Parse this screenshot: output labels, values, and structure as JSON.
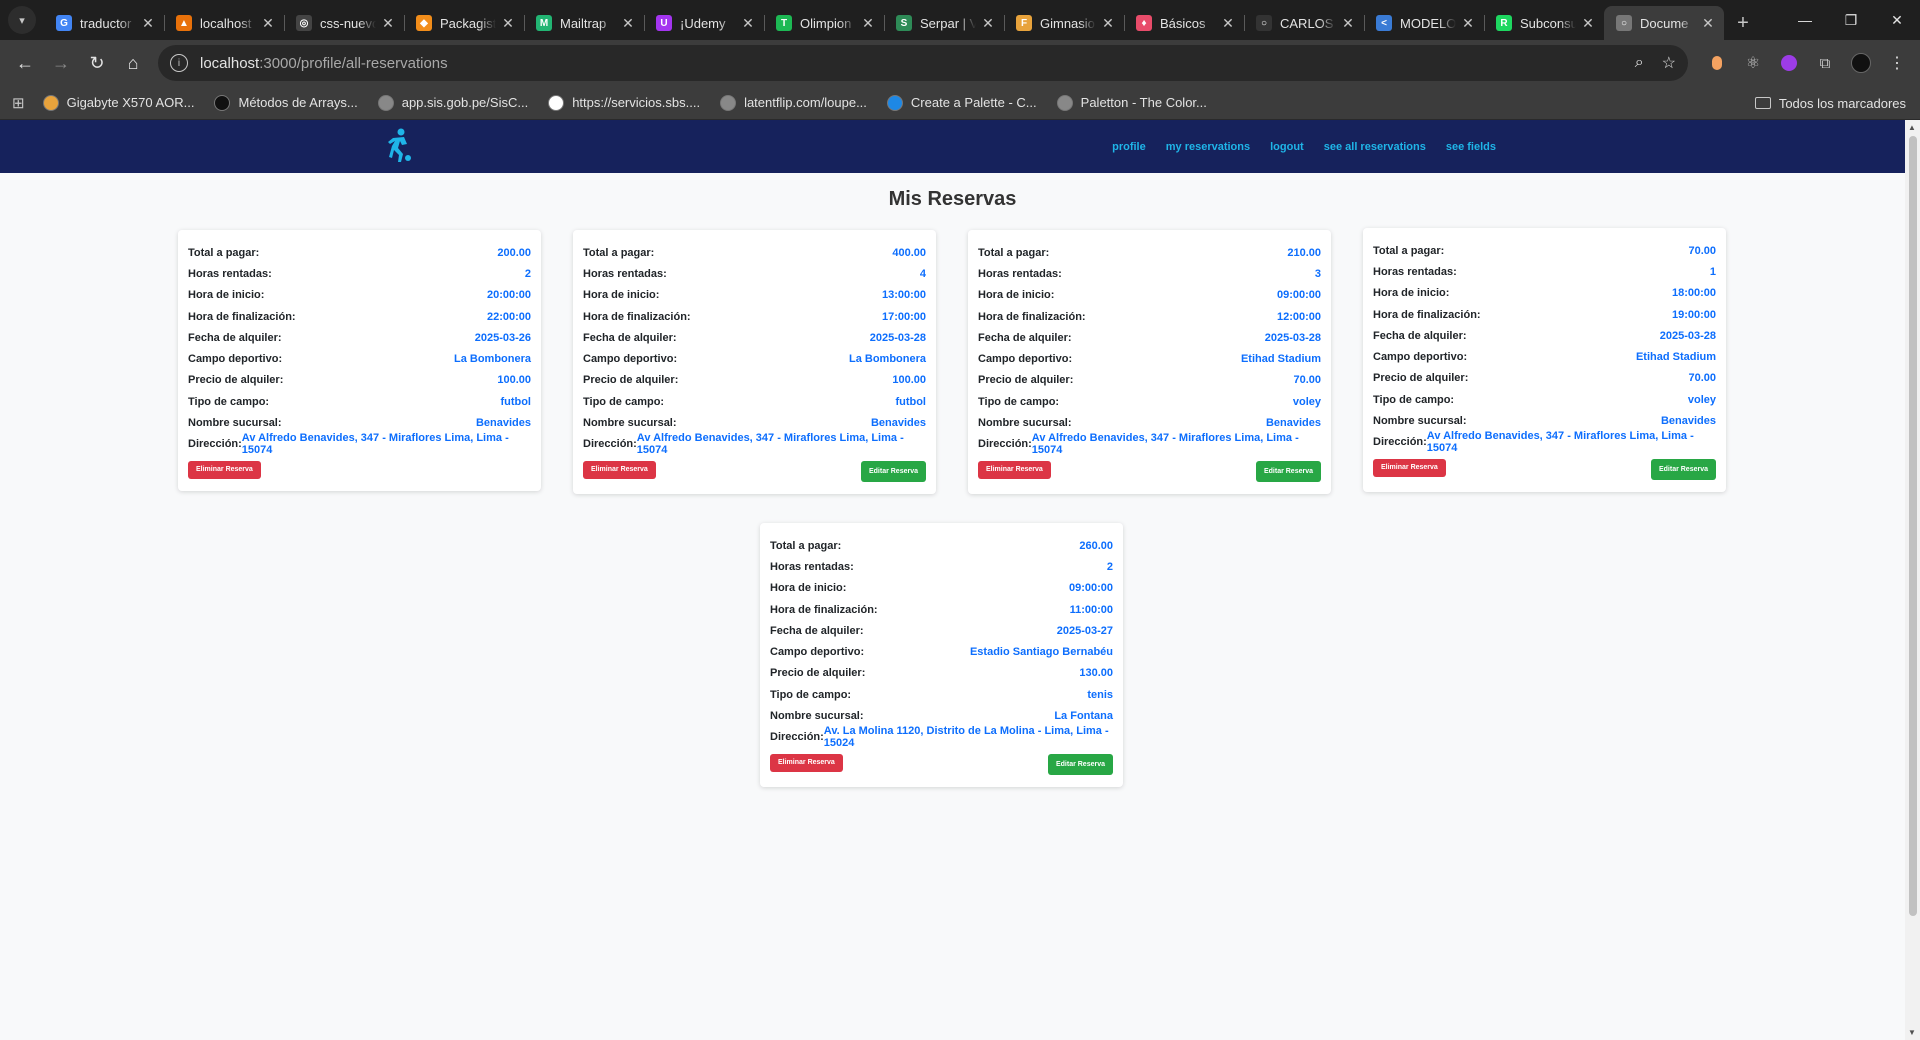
{
  "browser": {
    "tabs": [
      {
        "title": "traductor",
        "color": "#4285f4",
        "glyph": "G"
      },
      {
        "title": "localhost",
        "color": "#e8710a",
        "glyph": "▲"
      },
      {
        "title": "css-nuevo",
        "color": "#444444",
        "glyph": "◎"
      },
      {
        "title": "Packagist",
        "color": "#f28d1a",
        "glyph": "◆"
      },
      {
        "title": "Mailtrap",
        "color": "#22b573",
        "glyph": "M"
      },
      {
        "title": "¡Udemy",
        "color": "#a435f0",
        "glyph": "U"
      },
      {
        "title": "Olimpion",
        "color": "#1db954",
        "glyph": "T"
      },
      {
        "title": "Serpar | V",
        "color": "#2e8b57",
        "glyph": "S"
      },
      {
        "title": "Gimnasio",
        "color": "#e8a33c",
        "glyph": "F"
      },
      {
        "title": "Básicos",
        "color": "#e84c6a",
        "glyph": "♦"
      },
      {
        "title": "CARLOS",
        "color": "#333333",
        "glyph": "○"
      },
      {
        "title": "MODELO",
        "color": "#3a7bd5",
        "glyph": "<"
      },
      {
        "title": "Subconsu",
        "color": "#1ed760",
        "glyph": "R"
      },
      {
        "title": "Docume",
        "color": "#777777",
        "glyph": "○",
        "active": true
      }
    ],
    "url_host": "localhost",
    "url_path": ":3000/profile/all-reservations",
    "bookmarks": [
      {
        "label": "Gigabyte X570 AOR...",
        "color": "#e8a33c"
      },
      {
        "label": "Métodos de Arrays...",
        "color": "#111111"
      },
      {
        "label": "app.sis.gob.pe/SisC...",
        "color": "#888888"
      },
      {
        "label": "https://servicios.sbs....",
        "color": "#ffffff"
      },
      {
        "label": "latentflip.com/loupe...",
        "color": "#888888"
      },
      {
        "label": "Create a Palette - C...",
        "color": "#1e88e5"
      },
      {
        "label": "Paletton - The Color...",
        "color": "#888888"
      }
    ],
    "bookmarks_all": "Todos los marcadores"
  },
  "nav": {
    "links": [
      "profile",
      "my reservations",
      "logout",
      "see all reservations",
      "see fields"
    ]
  },
  "page_title": "Mis Reservas",
  "labels": {
    "total": "Total a pagar:",
    "hours": "Horas rentadas:",
    "start": "Hora de inicio:",
    "end": "Hora de finalización:",
    "date": "Fecha de alquiler:",
    "field": "Campo deportivo:",
    "price": "Precio de alquiler:",
    "type": "Tipo de campo:",
    "branch": "Nombre sucursal:",
    "address": "Dirección:",
    "delete_button": "Eliminar Reserva",
    "edit_button": "Editar Reserva"
  },
  "reservations": [
    {
      "total": "200.00",
      "hours": "2",
      "start": "20:00:00",
      "end": "22:00:00",
      "date": "2025-03-26",
      "field": "La Bombonera",
      "price": "100.00",
      "type": "futbol",
      "branch": "Benavides",
      "address": "Av Alfredo Benavides, 347 - Miraflores Lima, Lima - 15074",
      "editable": false
    },
    {
      "total": "400.00",
      "hours": "4",
      "start": "13:00:00",
      "end": "17:00:00",
      "date": "2025-03-28",
      "field": "La Bombonera",
      "price": "100.00",
      "type": "futbol",
      "branch": "Benavides",
      "address": "Av Alfredo Benavides, 347 - Miraflores Lima, Lima - 15074",
      "editable": true
    },
    {
      "total": "210.00",
      "hours": "3",
      "start": "09:00:00",
      "end": "12:00:00",
      "date": "2025-03-28",
      "field": "Etihad Stadium",
      "price": "70.00",
      "type": "voley",
      "branch": "Benavides",
      "address": "Av Alfredo Benavides, 347 - Miraflores Lima, Lima - 15074",
      "editable": true
    },
    {
      "total": "70.00",
      "hours": "1",
      "start": "18:00:00",
      "end": "19:00:00",
      "date": "2025-03-28",
      "field": "Etihad Stadium",
      "price": "70.00",
      "type": "voley",
      "branch": "Benavides",
      "address": "Av Alfredo Benavides, 347 - Miraflores Lima, Lima - 15074",
      "editable": true
    },
    {
      "total": "260.00",
      "hours": "2",
      "start": "09:00:00",
      "end": "11:00:00",
      "date": "2025-03-27",
      "field": "Estadio Santiago Bernabéu",
      "price": "130.00",
      "type": "tenis",
      "branch": "La Fontana",
      "address": "Av. La Molina 1120, Distrito de La Molina - Lima, Lima - 15024",
      "editable": true
    }
  ]
}
